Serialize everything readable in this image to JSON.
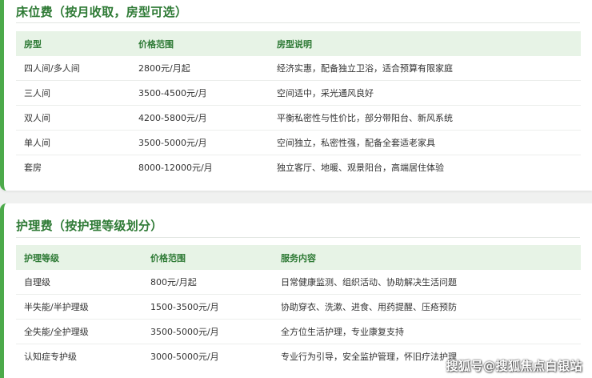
{
  "bed_fee": {
    "title": "床位费（按月收取，房型可选）",
    "headers": [
      "房型",
      "价格范围",
      "房型说明"
    ],
    "rows": [
      [
        "四人间/多人间",
        "2800元/月起",
        "经济实惠，配备独立卫浴，适合预算有限家庭"
      ],
      [
        "三人间",
        "3500-4500元/月",
        "空间适中，采光通风良好"
      ],
      [
        "双人间",
        "4200-5800元/月",
        "平衡私密性与性价比，部分带阳台、新风系统"
      ],
      [
        "单人间",
        "3500-5000元/月",
        "空间独立，私密性强，配备全套适老家具"
      ],
      [
        "套房",
        "8000-12000元/月",
        "独立客厅、地暖、观景阳台，高端居住体验"
      ]
    ]
  },
  "care_fee": {
    "title": "护理费（按护理等级划分）",
    "headers": [
      "护理等级",
      "价格范围",
      "服务内容"
    ],
    "rows": [
      [
        "自理级",
        "800元/月起",
        "日常健康监测、组织活动、协助解决生活问题"
      ],
      [
        "半失能/半护理级",
        "1500-3500元/月",
        "协助穿衣、洗漱、进食、用药提醒、压疮预防"
      ],
      [
        "全失能/全护理级",
        "3500-5000元/月",
        "全方位生活护理，专业康复支持"
      ],
      [
        "认知症专护级",
        "3000-5000元/月",
        "专业行为引导，安全监护管理，怀旧疗法护理"
      ]
    ]
  },
  "watermark": "搜狐号@搜狐焦点白银站",
  "colors": {
    "accent": "#4caa4a",
    "title": "#2e7a35",
    "header_bg": "#e7f3e6"
  }
}
